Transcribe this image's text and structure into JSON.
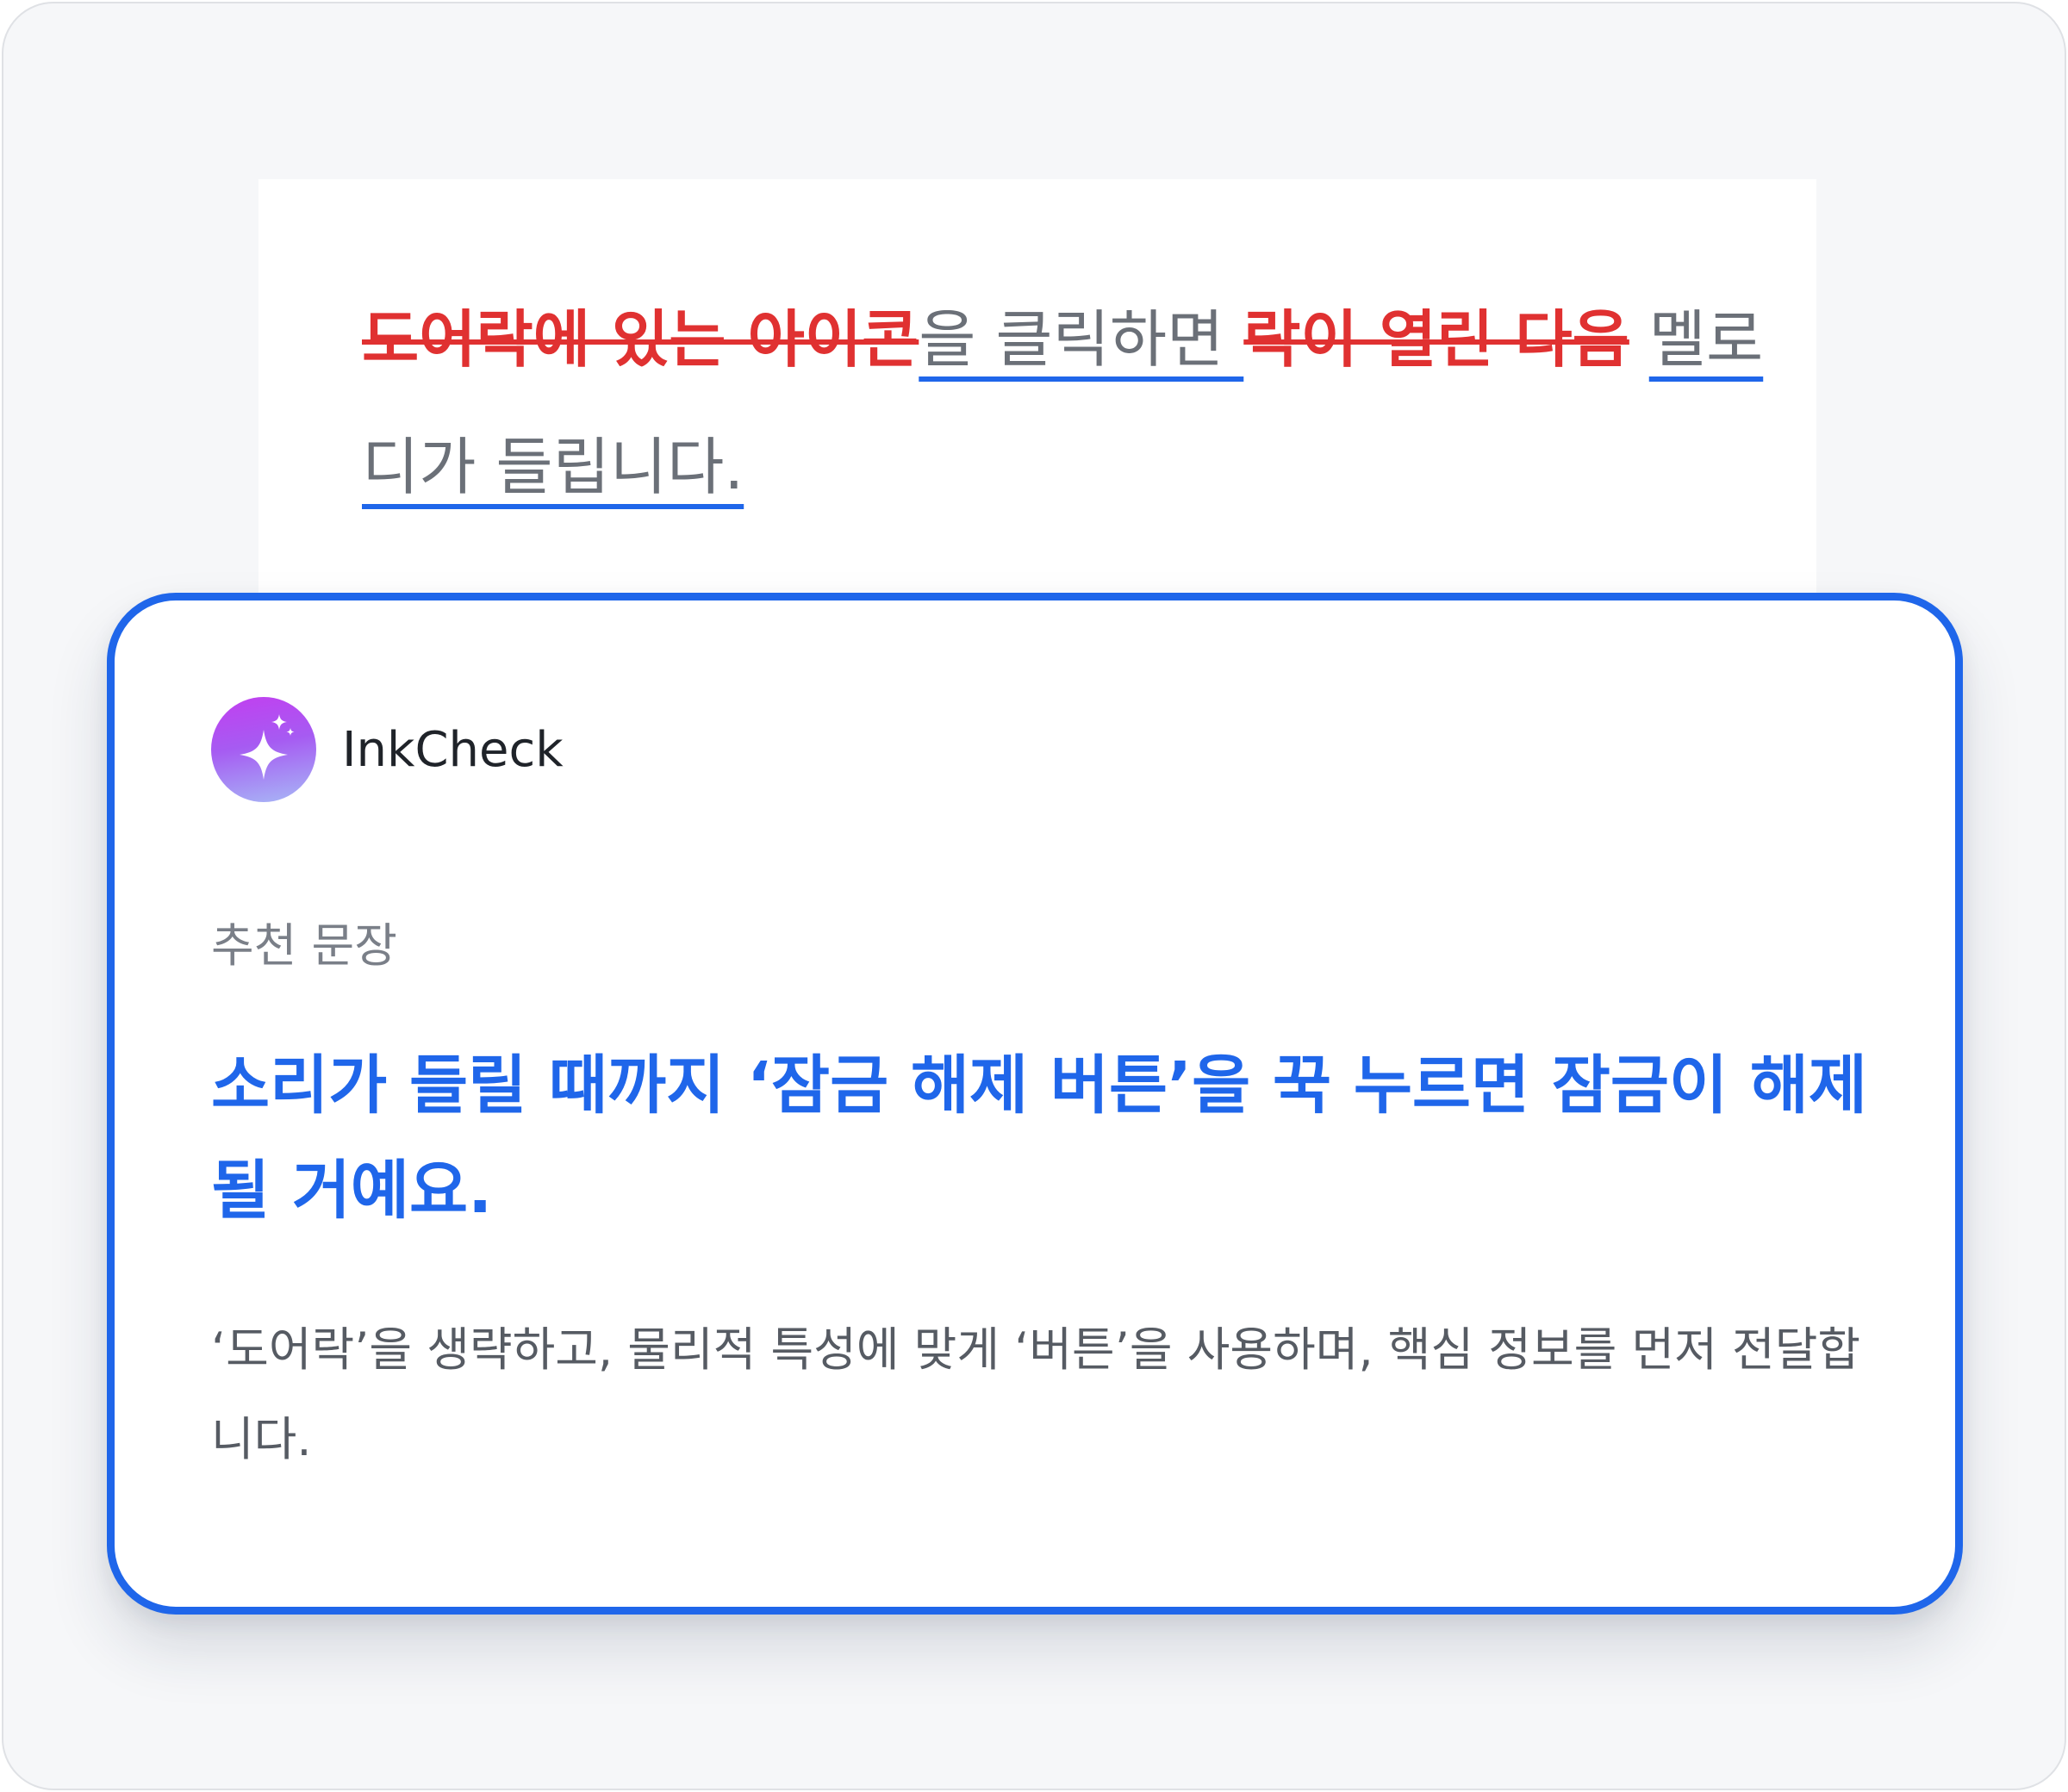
{
  "document": {
    "segments": [
      {
        "text": "도어락에 있는 아이콘",
        "style": "strike"
      },
      {
        "text": "을 클릭하면 ",
        "style": "under"
      },
      {
        "text": "락이 열린 다음",
        "style": "strike"
      },
      {
        "text": " ",
        "style": "plain"
      },
      {
        "text": "멜로디가 들립니다.",
        "style": "under"
      }
    ]
  },
  "card": {
    "brand_name": "InkCheck",
    "logo_icon": "sparkle-icon",
    "section_label": "추천 문장",
    "suggestion": "소리가 들릴 때까지 ‘잠금 해제 버튼’을 꾹 누르면 잠금이 해제될 거예요.",
    "explanation": "‘도어락’을 생략하고, 물리적 특성에 맞게 ‘버튼’을 사용하며, 핵심 정보를 먼저 전달합니다."
  },
  "colors": {
    "accent": "#1f66ea",
    "deletion": "#e03131",
    "original_text": "#6b7078"
  }
}
